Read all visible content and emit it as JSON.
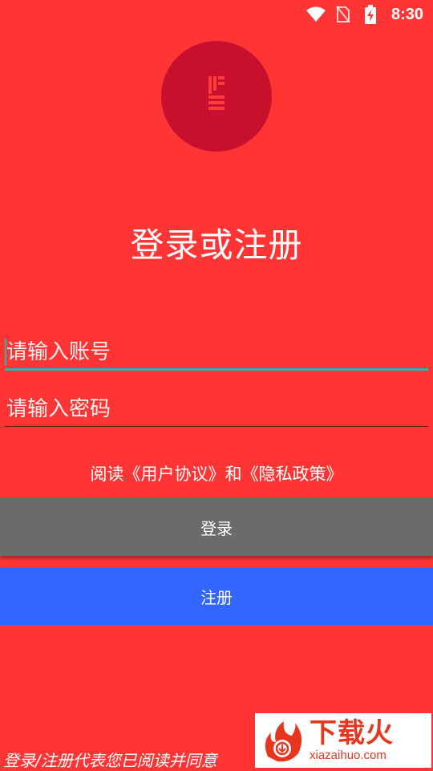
{
  "status_bar": {
    "time": "8:30",
    "icons": [
      "wifi-icon",
      "no-sim-icon",
      "battery-charging-icon"
    ]
  },
  "logo": {
    "icon": "app-logo-icon",
    "color": "#c8102e"
  },
  "title": "登录或注册",
  "form": {
    "account_placeholder": "请输入账号",
    "account_value": "",
    "password_placeholder": "请输入密码",
    "password_value": ""
  },
  "agreement_text": "阅读《用户协议》和《隐私政策》",
  "buttons": {
    "login_label": "登录",
    "register_label": "注册"
  },
  "footer_note": "登录/注册代表您已阅读并同意",
  "watermark": {
    "brand": "下载火",
    "url": "xiazaihuo.com"
  },
  "colors": {
    "background": "#ff3535",
    "login_button": "#6b6b6b",
    "register_button": "#3366ff",
    "focus_accent": "#2bb5a8"
  }
}
